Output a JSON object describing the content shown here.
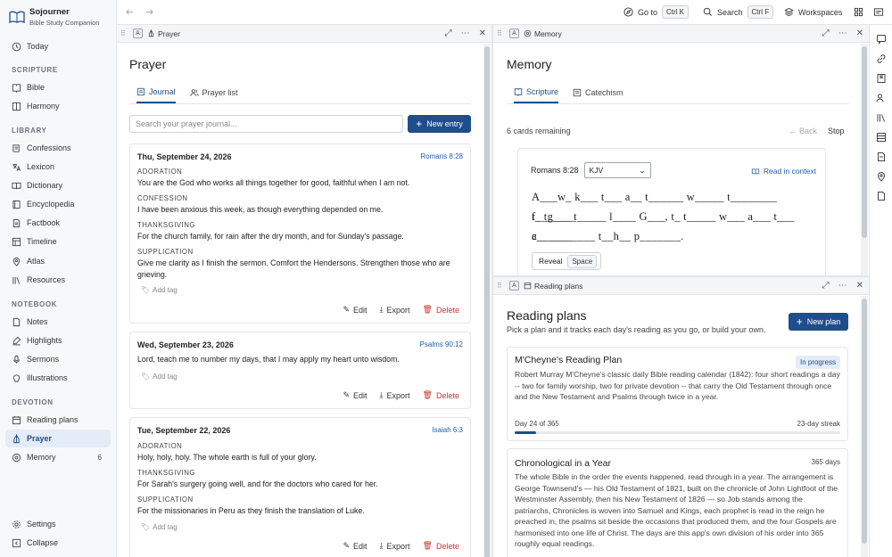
{
  "app": {
    "name": "Sojourner",
    "subtitle": "Bible Study Companion"
  },
  "topbar": {
    "goto_label": "Go to",
    "goto_kbd": "Ctrl K",
    "search_label": "Search",
    "search_kbd": "Ctrl F",
    "workspaces_label": "Workspaces"
  },
  "sidebar": {
    "today": "Today",
    "sections": {
      "scripture": "SCRIPTURE",
      "library": "LIBRARY",
      "notebook": "NOTEBOOK",
      "devotion": "DEVOTION"
    },
    "scripture": [
      "Bible",
      "Harmony"
    ],
    "library": [
      "Confessions",
      "Lexicon",
      "Dictionary",
      "Encyclopedia",
      "Factbook",
      "Timeline",
      "Atlas",
      "Resources"
    ],
    "notebook": [
      "Notes",
      "Highlights",
      "Sermons",
      "Illustrations"
    ],
    "devotion": [
      "Reading plans",
      "Prayer",
      "Memory"
    ],
    "memory_badge": "6",
    "settings": "Settings",
    "collapse": "Collapse"
  },
  "prayer": {
    "pane_title": "Prayer",
    "heading": "Prayer",
    "tabs": [
      "Journal",
      "Prayer list"
    ],
    "search_placeholder": "Search your prayer journal...",
    "new_entry": "New entry",
    "add_tag": "Add tag",
    "edit": "Edit",
    "export": "Export",
    "delete": "Delete",
    "entries": [
      {
        "date": "Thu, September 24, 2026",
        "ref": "Romans 8:28",
        "sections": [
          {
            "label": "ADORATION",
            "text": "You are the God who works all things together for good, faithful when I am not."
          },
          {
            "label": "CONFESSION",
            "text": "I have been anxious this week, as though everything depended on me."
          },
          {
            "label": "THANKSGIVING",
            "text": "For the church family, for rain after the dry month, and for Sunday's passage."
          },
          {
            "label": "SUPPLICATION",
            "text": "Give me clarity as I finish the sermon. Comfort the Hendersons. Strengthen those who are grieving."
          }
        ]
      },
      {
        "date": "Wed, September 23, 2026",
        "ref": "Psalms 90:12",
        "text": "Lord, teach me to number my days, that I may apply my heart unto wisdom."
      },
      {
        "date": "Tue, September 22, 2026",
        "ref": "Isaiah 6:3",
        "sections": [
          {
            "label": "ADORATION",
            "text": "Holy, holy, holy. The whole earth is full of your glory."
          },
          {
            "label": "THANKSGIVING",
            "text": "For Sarah's surgery going well, and for the doctors who cared for her."
          },
          {
            "label": "SUPPLICATION",
            "text": "For the missionaries in Peru as they finish the translation of Luke."
          }
        ]
      }
    ]
  },
  "memory": {
    "pane_title": "Memory",
    "heading": "Memory",
    "tabs": [
      "Scripture",
      "Catechism"
    ],
    "remaining": "6 cards remaining",
    "back": "Back",
    "stop": "Stop",
    "verse_ref": "Romans 8:28",
    "translation": "KJV",
    "read_in_context": "Read in context",
    "cloze_lines": [
      "A___w_ k___ t___ a__ t______ w_____ t________ f__g____",
      "t_ t____ t_____ l____ G___, t_ t_____ w___ a___ t___ c______",
      "a__________ t__h__ p_______."
    ],
    "reveal": "Reveal",
    "reveal_kbd": "Space"
  },
  "plans": {
    "pane_title": "Reading plans",
    "heading": "Reading plans",
    "subtitle": "Pick a plan and it tracks each day's reading as you go, or build your own.",
    "new_plan": "New plan",
    "items": [
      {
        "title": "M'Cheyne's Reading Plan",
        "status": "In progress",
        "desc": "Robert Murray M'Cheyne's classic daily Bible reading calendar (1842): four short readings a day -- two for family worship, two for private devotion -- that carry the Old Testament through once and the New Testament and Psalms through twice in a year.",
        "progress_label": "Day 24 of 365",
        "progress": 0.066,
        "streak": "23-day streak"
      },
      {
        "title": "Chronological in a Year",
        "days": "365 days",
        "desc": "The whole Bible in the order the events happened, read through in a year. The arrangement is George Townsend's — his Old Testament of 1821, built on the chronicle of John Lightfoot of the Westminster Assembly, then his New Testament of 1826 — so Job stands among the patriarchs, Chronicles is woven into Samuel and Kings, each prophet is read in the reign he preached in, the psalms sit beside the occasions that produced them, and the four Gospels are harmonised into one life of Christ. The days are this app's own division of his order into 365 roughly equal readings."
      }
    ]
  },
  "colors": {
    "accent": "#1f4e8c",
    "danger": "#c0392b",
    "link": "#1f5fa8"
  }
}
